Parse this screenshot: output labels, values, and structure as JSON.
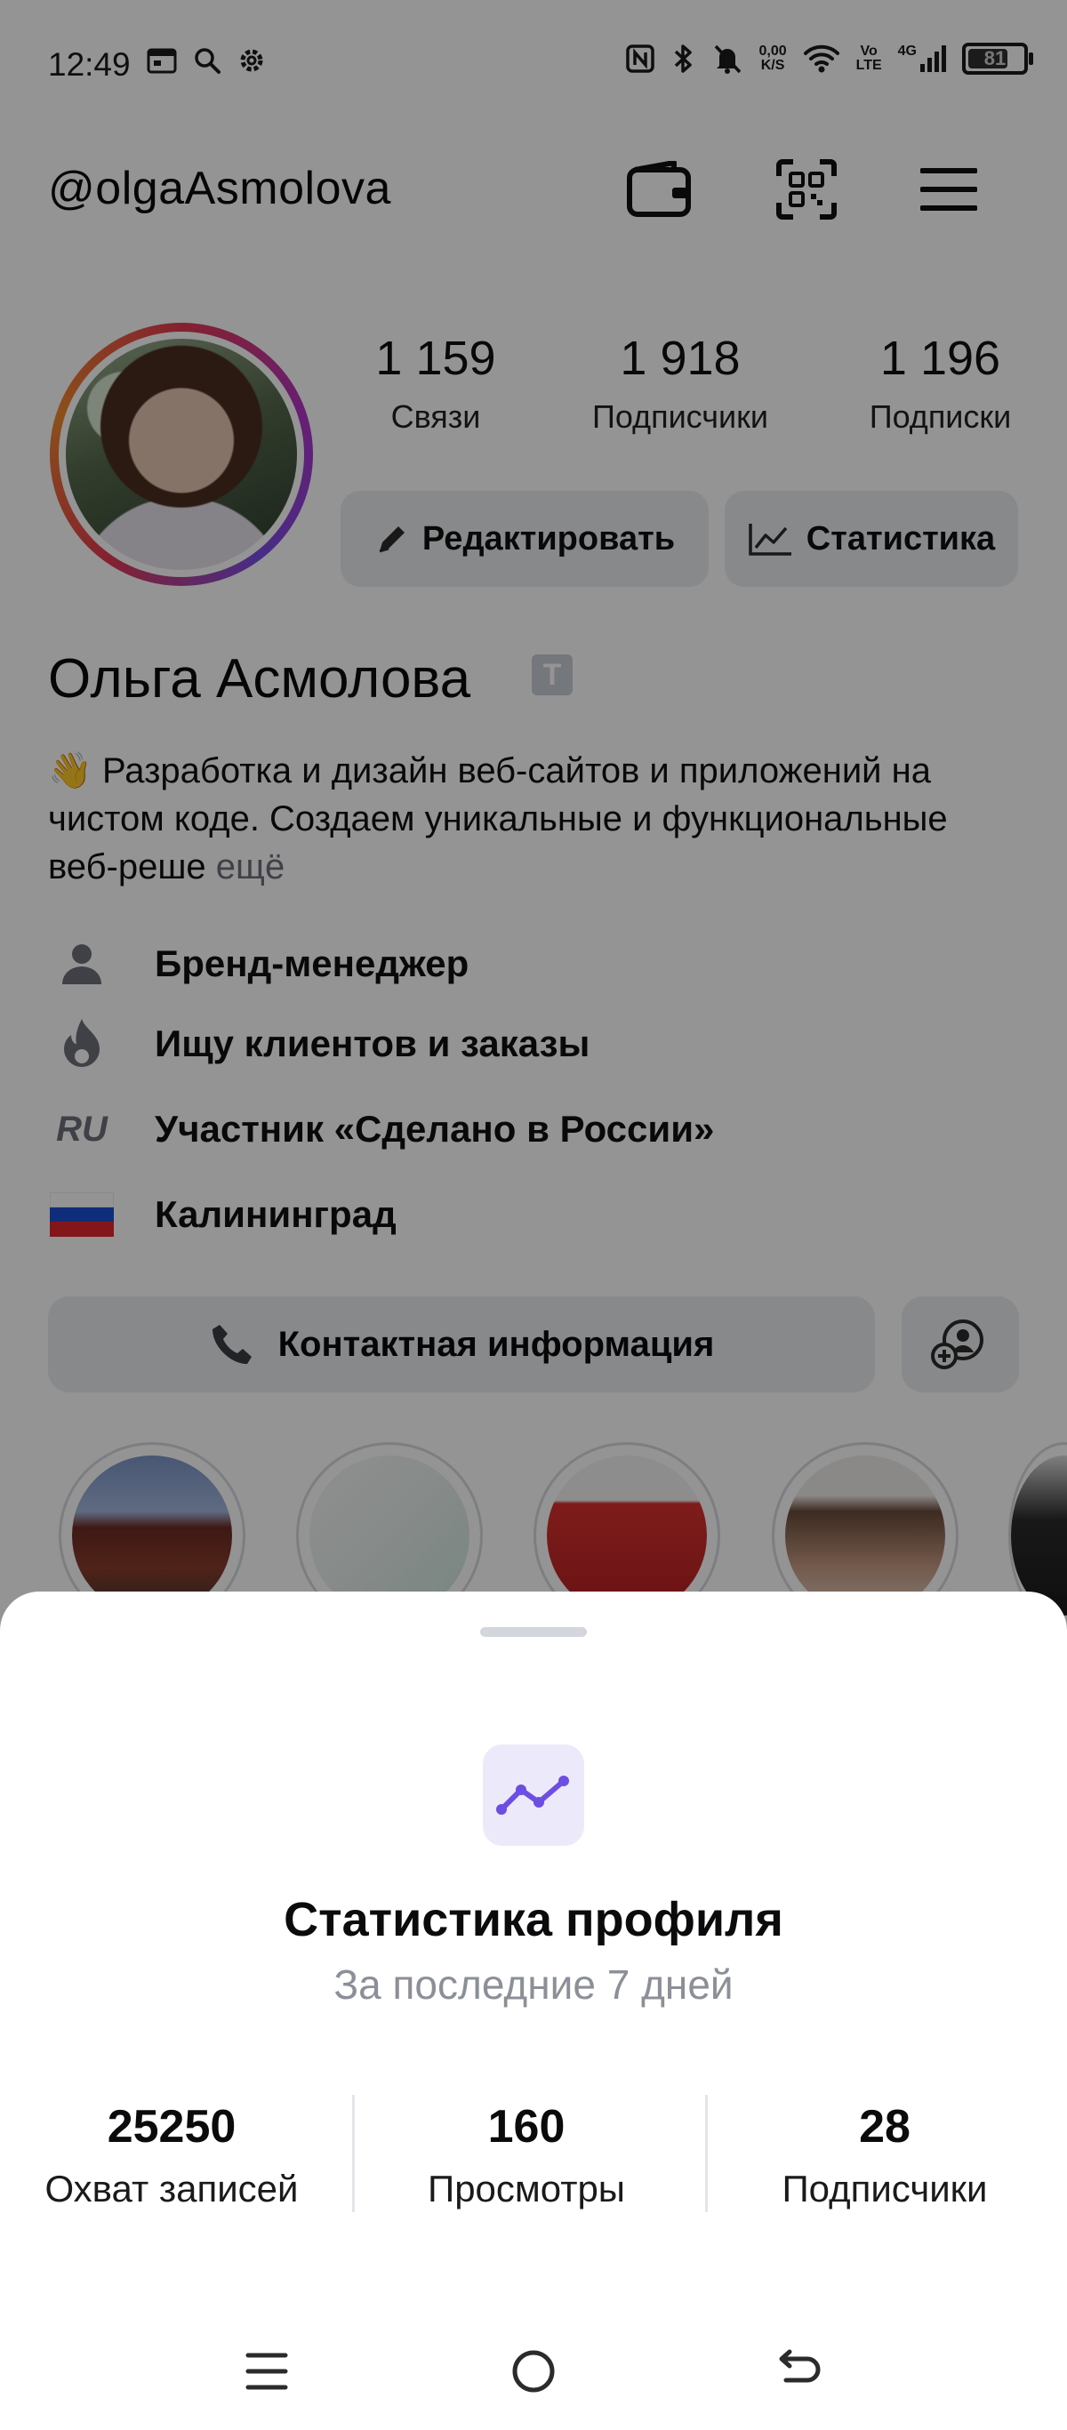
{
  "status_bar": {
    "time": "12:49",
    "net_speed_value": "0,00",
    "net_speed_unit": "K/S",
    "volte_top": "Vo",
    "volte_bottom": "LTE",
    "network": "4G",
    "battery": "81"
  },
  "header": {
    "username": "@olgaAsmolova"
  },
  "profile": {
    "stats": [
      {
        "value": "1 159",
        "label": "Связи"
      },
      {
        "value": "1 918",
        "label": "Подписчики"
      },
      {
        "value": "1 196",
        "label": "Подписки"
      }
    ],
    "edit_label": "Редактировать",
    "stats_label": "Статистика",
    "name": "Ольга Асмолова",
    "verified_glyph": "T",
    "bio_emoji": "👋",
    "bio": "Разработка и дизайн веб-сайтов и приложений на чистом коде. Создаем уникальные и функциональные веб-реше",
    "bio_more": "ещё",
    "info": [
      {
        "icon": "person-icon",
        "text": "Бренд-менеджер"
      },
      {
        "icon": "fire-icon",
        "text": "Ищу клиентов и заказы"
      },
      {
        "icon": "ru-icon",
        "icon_text": "RU",
        "text": "Участник «Сделано в России»"
      },
      {
        "icon": "russia-flag-icon",
        "text": "Калининград"
      }
    ],
    "contact_label": "Контактная информация"
  },
  "sheet": {
    "title": "Статистика профиля",
    "subtitle": "За последние 7 дней",
    "metrics": [
      {
        "value": "25250",
        "label": "Охват записей"
      },
      {
        "value": "160",
        "label": "Просмотры"
      },
      {
        "value": "28",
        "label": "Подписчики"
      }
    ]
  },
  "colors": {
    "accent": "#6c4ee3",
    "sheet_icon_bg": "#ece9fb",
    "button_bg": "#ebedf0"
  }
}
